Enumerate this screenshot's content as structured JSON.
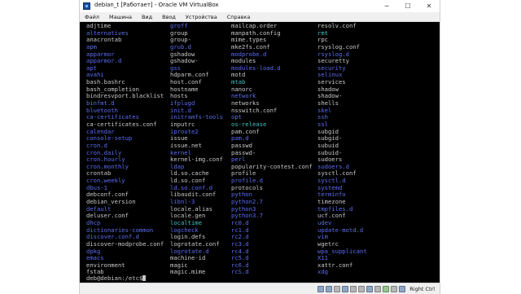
{
  "window": {
    "title": "debian_t [Работает] - Oracle VM VirtualBox",
    "minimize_glyph": "─",
    "maximize_glyph": "☐",
    "close_glyph": "✕"
  },
  "menu": [
    "Файл",
    "Машина",
    "Вид",
    "Ввод",
    "Устройства",
    "Справка"
  ],
  "colors": {
    "terminal_bg": "#000000",
    "plain_file": "#c8c8c8",
    "directory": "#5d6df0",
    "symlink": "#3fc3c3"
  },
  "listing": {
    "col1": [
      {
        "n": "adjtime",
        "t": "w"
      },
      {
        "n": "alternatives",
        "t": "b"
      },
      {
        "n": "anacrontab",
        "t": "w"
      },
      {
        "n": "apm",
        "t": "b"
      },
      {
        "n": "apparmor",
        "t": "b"
      },
      {
        "n": "apparmor.d",
        "t": "b"
      },
      {
        "n": "apt",
        "t": "b"
      },
      {
        "n": "avahi",
        "t": "b"
      },
      {
        "n": "bash.bashrc",
        "t": "w"
      },
      {
        "n": "bash_completion",
        "t": "w"
      },
      {
        "n": "bindresvport.blacklist",
        "t": "w"
      },
      {
        "n": "binfmt.d",
        "t": "b"
      },
      {
        "n": "bluetooth",
        "t": "b"
      },
      {
        "n": "ca-certificates",
        "t": "b"
      },
      {
        "n": "ca-certificates.conf",
        "t": "w"
      },
      {
        "n": "calendar",
        "t": "b"
      },
      {
        "n": "console-setup",
        "t": "b"
      },
      {
        "n": "cron.d",
        "t": "b"
      },
      {
        "n": "cron.daily",
        "t": "b"
      },
      {
        "n": "cron.hourly",
        "t": "b"
      },
      {
        "n": "cron.monthly",
        "t": "b"
      },
      {
        "n": "crontab",
        "t": "w"
      },
      {
        "n": "cron.weekly",
        "t": "b"
      },
      {
        "n": "dbus-1",
        "t": "b"
      },
      {
        "n": "debconf.conf",
        "t": "w"
      },
      {
        "n": "debian_version",
        "t": "w"
      },
      {
        "n": "default",
        "t": "b"
      },
      {
        "n": "deluser.conf",
        "t": "w"
      },
      {
        "n": "dhcp",
        "t": "b"
      },
      {
        "n": "dictionaries-common",
        "t": "b"
      },
      {
        "n": "discover.conf.d",
        "t": "b"
      },
      {
        "n": "discover-modprobe.conf",
        "t": "w"
      },
      {
        "n": "dpkg",
        "t": "b"
      },
      {
        "n": "emacs",
        "t": "b"
      },
      {
        "n": "environment",
        "t": "w"
      },
      {
        "n": "fstab",
        "t": "w"
      }
    ],
    "col2": [
      {
        "n": "groff",
        "t": "b"
      },
      {
        "n": "group",
        "t": "w"
      },
      {
        "n": "group-",
        "t": "w"
      },
      {
        "n": "grub.d",
        "t": "b"
      },
      {
        "n": "gshadow",
        "t": "w"
      },
      {
        "n": "gshadow-",
        "t": "w"
      },
      {
        "n": "gss",
        "t": "b"
      },
      {
        "n": "hdparm.conf",
        "t": "w"
      },
      {
        "n": "host.conf",
        "t": "w"
      },
      {
        "n": "hostname",
        "t": "w"
      },
      {
        "n": "hosts",
        "t": "w"
      },
      {
        "n": "ifplugd",
        "t": "b"
      },
      {
        "n": "init.d",
        "t": "b"
      },
      {
        "n": "initramfs-tools",
        "t": "b"
      },
      {
        "n": "inputrc",
        "t": "w"
      },
      {
        "n": "iproute2",
        "t": "b"
      },
      {
        "n": "issue",
        "t": "w"
      },
      {
        "n": "issue.net",
        "t": "w"
      },
      {
        "n": "kernel",
        "t": "b"
      },
      {
        "n": "kernel-img.conf",
        "t": "w"
      },
      {
        "n": "ldap",
        "t": "b"
      },
      {
        "n": "ld.so.cache",
        "t": "w"
      },
      {
        "n": "ld.so.conf",
        "t": "w"
      },
      {
        "n": "ld.so.conf.d",
        "t": "b"
      },
      {
        "n": "libaudit.conf",
        "t": "w"
      },
      {
        "n": "libnl-3",
        "t": "b"
      },
      {
        "n": "locale.alias",
        "t": "w"
      },
      {
        "n": "locale.gen",
        "t": "w"
      },
      {
        "n": "localtime",
        "t": "c"
      },
      {
        "n": "logcheck",
        "t": "b"
      },
      {
        "n": "login.defs",
        "t": "w"
      },
      {
        "n": "logrotate.conf",
        "t": "w"
      },
      {
        "n": "logrotate.d",
        "t": "b"
      },
      {
        "n": "machine-id",
        "t": "w"
      },
      {
        "n": "magic",
        "t": "w"
      },
      {
        "n": "magic.mime",
        "t": "w"
      }
    ],
    "col3": [
      {
        "n": "mailcap.order",
        "t": "w"
      },
      {
        "n": "manpath.config",
        "t": "w"
      },
      {
        "n": "mime.types",
        "t": "w"
      },
      {
        "n": "mke2fs.conf",
        "t": "w"
      },
      {
        "n": "modprobe.d",
        "t": "b"
      },
      {
        "n": "modules",
        "t": "w"
      },
      {
        "n": "modules-load.d",
        "t": "b"
      },
      {
        "n": "motd",
        "t": "w"
      },
      {
        "n": "mtab",
        "t": "c"
      },
      {
        "n": "nanorc",
        "t": "w"
      },
      {
        "n": "network",
        "t": "b"
      },
      {
        "n": "networks",
        "t": "w"
      },
      {
        "n": "nsswitch.conf",
        "t": "w"
      },
      {
        "n": "opt",
        "t": "b"
      },
      {
        "n": "os-release",
        "t": "c"
      },
      {
        "n": "pam.conf",
        "t": "w"
      },
      {
        "n": "pam.d",
        "t": "b"
      },
      {
        "n": "passwd",
        "t": "w"
      },
      {
        "n": "passwd-",
        "t": "w"
      },
      {
        "n": "perl",
        "t": "b"
      },
      {
        "n": "popularity-contest.conf",
        "t": "w"
      },
      {
        "n": "profile",
        "t": "w"
      },
      {
        "n": "profile.d",
        "t": "b"
      },
      {
        "n": "protocols",
        "t": "w"
      },
      {
        "n": "python",
        "t": "b"
      },
      {
        "n": "python2.7",
        "t": "b"
      },
      {
        "n": "python3",
        "t": "b"
      },
      {
        "n": "python3.7",
        "t": "b"
      },
      {
        "n": "rc0.d",
        "t": "b"
      },
      {
        "n": "rc1.d",
        "t": "b"
      },
      {
        "n": "rc2.d",
        "t": "b"
      },
      {
        "n": "rc3.d",
        "t": "b"
      },
      {
        "n": "rc4.d",
        "t": "b"
      },
      {
        "n": "rc5.d",
        "t": "b"
      },
      {
        "n": "rc6.d",
        "t": "b"
      },
      {
        "n": "rcS.d",
        "t": "b"
      }
    ],
    "col4": [
      {
        "n": "resolv.conf",
        "t": "w"
      },
      {
        "n": "rmt",
        "t": "c"
      },
      {
        "n": "rpc",
        "t": "w"
      },
      {
        "n": "rsyslog.conf",
        "t": "w"
      },
      {
        "n": "rsyslog.d",
        "t": "b"
      },
      {
        "n": "securetty",
        "t": "w"
      },
      {
        "n": "security",
        "t": "b"
      },
      {
        "n": "selinux",
        "t": "b"
      },
      {
        "n": "services",
        "t": "w"
      },
      {
        "n": "shadow",
        "t": "w"
      },
      {
        "n": "shadow-",
        "t": "w"
      },
      {
        "n": "shells",
        "t": "w"
      },
      {
        "n": "skel",
        "t": "b"
      },
      {
        "n": "ssh",
        "t": "b"
      },
      {
        "n": "ssl",
        "t": "b"
      },
      {
        "n": "subgid",
        "t": "w"
      },
      {
        "n": "subgid-",
        "t": "w"
      },
      {
        "n": "subuid",
        "t": "w"
      },
      {
        "n": "subuid-",
        "t": "w"
      },
      {
        "n": "sudoers",
        "t": "w"
      },
      {
        "n": "sudoers.d",
        "t": "b"
      },
      {
        "n": "sysctl.conf",
        "t": "w"
      },
      {
        "n": "sysctl.d",
        "t": "b"
      },
      {
        "n": "systemd",
        "t": "b"
      },
      {
        "n": "terminfo",
        "t": "b"
      },
      {
        "n": "timezone",
        "t": "w"
      },
      {
        "n": "tmpfiles.d",
        "t": "b"
      },
      {
        "n": "ucf.conf",
        "t": "w"
      },
      {
        "n": "udev",
        "t": "b"
      },
      {
        "n": "update-motd.d",
        "t": "b"
      },
      {
        "n": "vim",
        "t": "b"
      },
      {
        "n": "wgetrc",
        "t": "w"
      },
      {
        "n": "wpa_supplicant",
        "t": "b"
      },
      {
        "n": "X11",
        "t": "b"
      },
      {
        "n": "xattr.conf",
        "t": "w"
      },
      {
        "n": "xdg",
        "t": "b"
      }
    ]
  },
  "prompt": "deb@debian:/etc$",
  "statusbar": {
    "icons": [
      "hdd-icon",
      "optical-icon",
      "audio-icon",
      "network-icon",
      "usb-icon",
      "shared-folder-icon",
      "display-icon",
      "recording-icon",
      "cpu-icon",
      "mouse-icon",
      "keyboard-icon"
    ],
    "hostkey": "Right Ctrl"
  }
}
